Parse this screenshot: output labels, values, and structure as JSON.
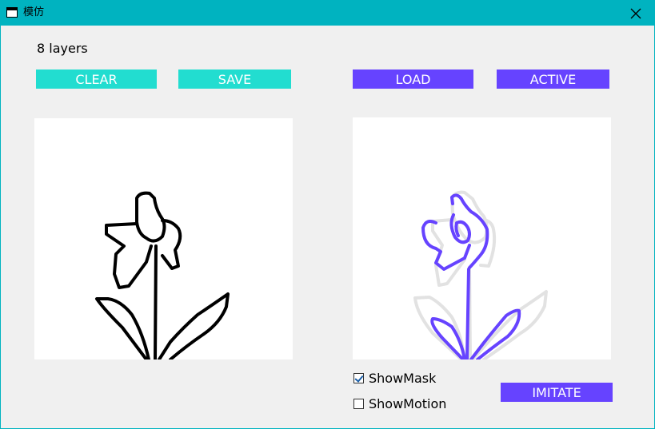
{
  "window": {
    "title": "模仿",
    "icon": "window-icon",
    "close_icon": "close-icon"
  },
  "layers": {
    "label": "8 layers"
  },
  "buttons": {
    "clear": "CLEAR",
    "save": "SAVE",
    "load": "LOAD",
    "active": "ACTIVE",
    "imitate": "IMITATE"
  },
  "options": {
    "show_mask": {
      "label": "ShowMask",
      "checked": true
    },
    "show_motion": {
      "label": "ShowMotion",
      "checked": false
    }
  },
  "colors": {
    "titlebar": "#00b3c0",
    "teal_button": "#22ddd0",
    "purple_button": "#6643ff",
    "left_stroke": "#000000",
    "right_stroke": "#6643ff",
    "mask_stroke": "#e2e2e2"
  }
}
